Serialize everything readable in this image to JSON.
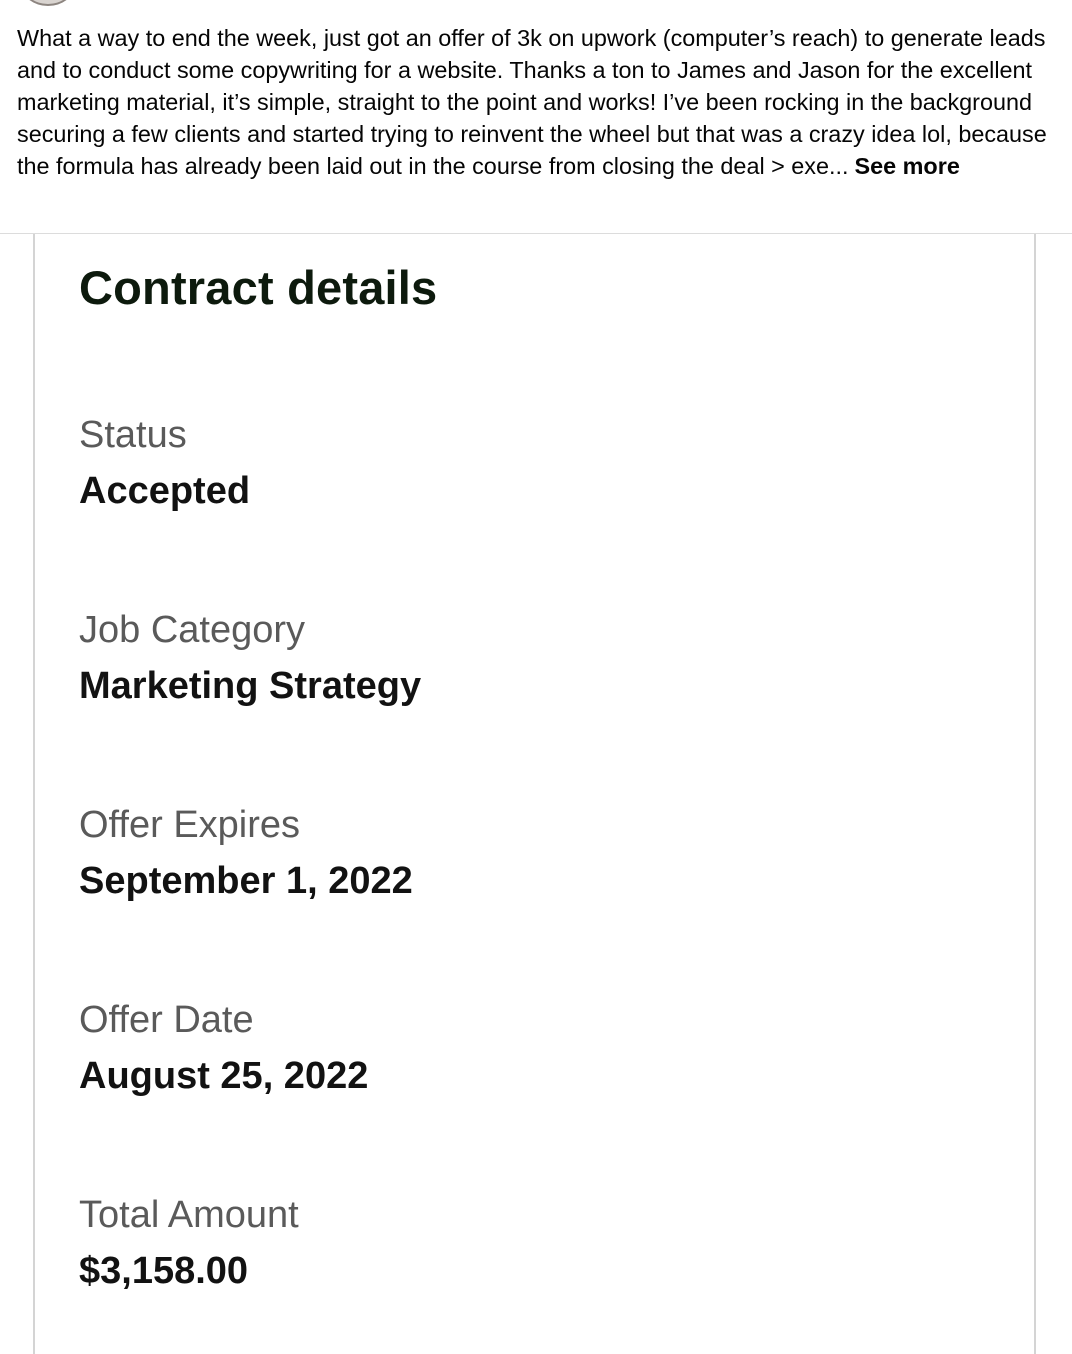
{
  "post": {
    "body_text": "What a way to end the week, just got an offer of 3k on upwork (computer’s reach) to generate leads and to conduct some copywriting for a website. Thanks a ton to James and Jason for the excellent marketing material, it’s simple, straight to the point and works! I’ve been rocking in the background securing a few clients and started trying to reinvent the wheel but that was a crazy idea lol, because the formula has already been laid out in the course from closing the deal > exe...",
    "see_more_label": "See more"
  },
  "contract": {
    "title": "Contract details",
    "fields": [
      {
        "label": "Status",
        "value": "Accepted"
      },
      {
        "label": "Job Category",
        "value": "Marketing Strategy"
      },
      {
        "label": "Offer Expires",
        "value": "September 1, 2022"
      },
      {
        "label": "Offer Date",
        "value": "August 25, 2022"
      },
      {
        "label": "Total Amount",
        "value": "$3,158.00"
      }
    ]
  }
}
